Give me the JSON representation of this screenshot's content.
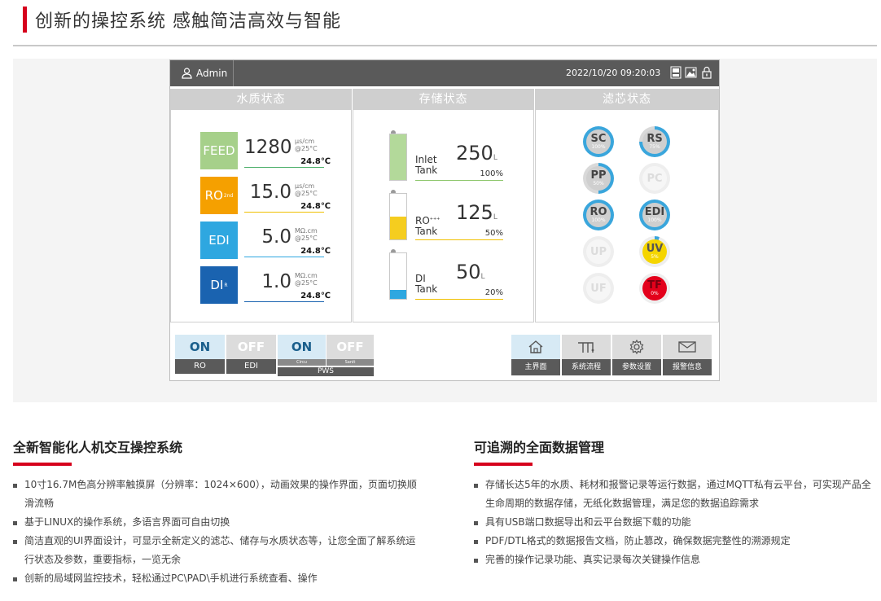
{
  "page_title": "创新的操控系统 感触简洁高效与智能",
  "screen": {
    "user": "Admin",
    "datetime": "2022/10/20 09:20:03",
    "icons": [
      "screen-icon",
      "image-icon",
      "lock-icon"
    ],
    "panels": {
      "water_quality": "水质状态",
      "storage": "存储状态",
      "filter": "滤芯状态"
    },
    "water_quality": [
      {
        "name": "FEED",
        "sup": "",
        "value": "1280",
        "unit1": "μs/cm",
        "unit2": "@25°C",
        "temp": "24.8℃",
        "color": "#a6d08a",
        "line": "#4caf6a"
      },
      {
        "name": "RO",
        "sup": "2nd",
        "value": "15.0",
        "unit1": "μs/cm",
        "unit2": "@25°C",
        "temp": "24.8℃",
        "color": "#f5a000",
        "line": "#f0c000"
      },
      {
        "name": "EDI",
        "sup": "",
        "value": "5.0",
        "unit1": "MΩ.cm",
        "unit2": "@25°C",
        "temp": "24.8℃",
        "color": "#2ea7e0",
        "line": "#2ea7e0"
      },
      {
        "name": "DI",
        "sup": "R",
        "value": "1.0",
        "unit1": "MΩ.cm",
        "unit2": "@25°C",
        "temp": "24.8℃",
        "color": "#1a63b0",
        "line": "#1a63b0"
      }
    ],
    "tanks": [
      {
        "name1": "Inlet",
        "sup": "",
        "name2": "Tank",
        "value": "250",
        "unit": "L",
        "pct": "100%",
        "fill": 1.0,
        "color": "#b3d99a",
        "line": "#8cc66b"
      },
      {
        "name1": "RO",
        "sup": "+++",
        "name2": "Tank",
        "value": "125",
        "unit": "L",
        "pct": "50%",
        "fill": 0.5,
        "color": "#f5cd1f",
        "line": "#f0c000"
      },
      {
        "name1": "DI",
        "sup": "",
        "name2": "Tank",
        "value": "50",
        "unit": "L",
        "pct": "20%",
        "fill": 0.2,
        "color": "#2ea7e0",
        "line": "#f0c000"
      }
    ],
    "filters": [
      {
        "name": "SC",
        "pct": "100%",
        "level": 1.0,
        "state": "ok"
      },
      {
        "name": "RS",
        "pct": "75%",
        "level": 0.75,
        "state": "ok"
      },
      {
        "name": "PP",
        "pct": "50%",
        "level": 0.5,
        "state": "ok"
      },
      {
        "name": "PC",
        "pct": "",
        "level": 0,
        "state": "disabled"
      },
      {
        "name": "RO",
        "pct": "100%",
        "level": 1.0,
        "state": "ok"
      },
      {
        "name": "EDI",
        "pct": "100%",
        "level": 1.0,
        "state": "ok"
      },
      {
        "name": "UP",
        "pct": "",
        "level": 0,
        "state": "disabled"
      },
      {
        "name": "UV",
        "pct": "5%",
        "level": 0.05,
        "state": "warn"
      },
      {
        "name": "UF",
        "pct": "",
        "level": 0,
        "state": "disabled"
      },
      {
        "name": "TF",
        "pct": "0%",
        "level": 0,
        "state": "alarm"
      }
    ],
    "switches": [
      {
        "state": "ON",
        "label": "RO"
      },
      {
        "state": "OFF",
        "label": "EDI"
      }
    ],
    "pws": {
      "on": "ON",
      "off": "OFF",
      "sub_on": "Circu",
      "sub_off": "Sanit",
      "label": "PWS"
    },
    "nav": [
      {
        "label": "主界面",
        "icon": "home-icon"
      },
      {
        "label": "系统流程",
        "icon": "flow-icon"
      },
      {
        "label": "参数设置",
        "icon": "gear-icon"
      },
      {
        "label": "报警信息",
        "icon": "mail-icon"
      }
    ]
  },
  "sections": [
    {
      "title": "全新智能化人机交互操控系统",
      "items": [
        "10寸16.7M色高分辨率触摸屏（分辨率：1024×600），动画效果的操作界面，页面切换顺滑流畅",
        "基于LINUX的操作系统，多语言界面可自由切换",
        "简洁直观的UI界面设计，可显示全新定义的滤芯、储存与水质状态等，让您全面了解系统运行状态及参数，重要指标，一览无余",
        "创新的局域网监控技术，轻松通过PC\\PAD\\手机进行系统查看、操作"
      ]
    },
    {
      "title": "可追溯的全面数据管理",
      "items": [
        "存储长达5年的水质、耗材和报警记录等运行数据，通过MQTT私有云平台，可实现产品全生命周期的数据存储，无纸化数据管理，满足您的数据追踪需求",
        "具有USB端口数据导出和云平台数据下载的功能",
        "PDF/DTL格式的数据报告文档，防止篡改，确保数据完整性的溯源规定",
        "完善的操作记录功能、真实记录每次关键操作信息"
      ]
    }
  ]
}
